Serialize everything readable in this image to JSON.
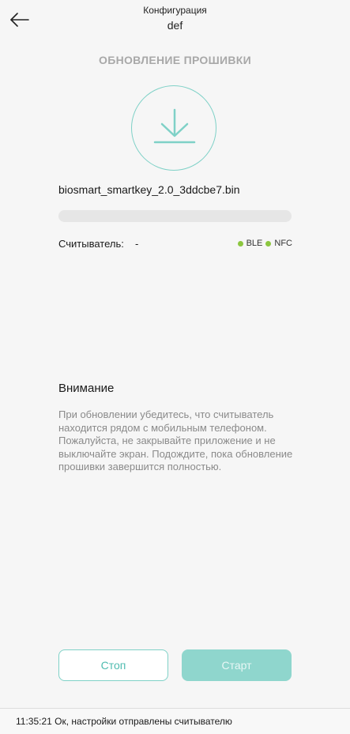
{
  "header": {
    "title": "Конфигурация",
    "subtitle": "def",
    "back_icon": "arrow-left-icon"
  },
  "firmware": {
    "section_title": "ОБНОВЛЕНИЕ ПРОШИВКИ",
    "icon": "download-icon",
    "filename": "biosmart_smartkey_2.0_3ddcbe7.bin",
    "progress": 0
  },
  "reader": {
    "label": "Считыватель:",
    "value": "-",
    "indicators": [
      {
        "label": "BLE",
        "color": "#8cc63f"
      },
      {
        "label": "NFC",
        "color": "#8cc63f"
      }
    ]
  },
  "attention": {
    "title": "Внимание",
    "body": "При обновлении убедитесь, что считыватель находится рядом с мобильным телефоном. Пожалуйста, не закрывайте приложение и не выключайте экран. Подождите, пока обновление прошивки завершится полностью."
  },
  "buttons": {
    "stop_label": "Стоп",
    "start_label": "Старт"
  },
  "status": {
    "text": "11:35:21 Ок, настройки отправлены считывателю"
  },
  "colors": {
    "accent": "#7fd1c7",
    "indicator": "#8cc63f",
    "background": "#f6f6f6"
  }
}
